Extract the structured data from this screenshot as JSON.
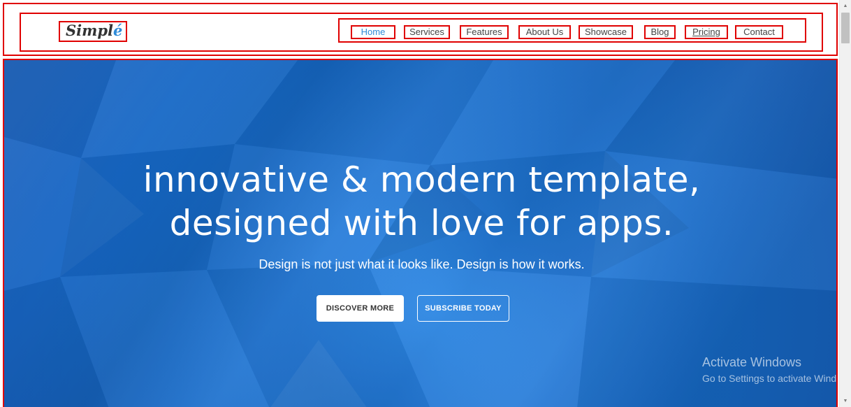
{
  "header": {
    "logo": {
      "text_main": "Simpl",
      "text_accent": "é"
    },
    "nav": {
      "active_color": "#2f8bd8",
      "items": [
        {
          "label": "Home",
          "active": true
        },
        {
          "label": "Services",
          "active": false
        },
        {
          "label": "Features",
          "active": false
        },
        {
          "label": "About Us",
          "active": false
        },
        {
          "label": "Showcase",
          "active": false
        },
        {
          "label": "Blog",
          "active": false
        },
        {
          "label": "Pricing",
          "active": false
        },
        {
          "label": "Contact",
          "active": false
        }
      ]
    }
  },
  "hero": {
    "background_color": "#1a6fd0",
    "title_line1": "innovative & modern template,",
    "title_line2": "designed with love for apps.",
    "subtitle": "Design is not just what it looks like. Design is how it works.",
    "buttons": {
      "discover": "DISCOVER MORE",
      "subscribe": "SUBSCRIBE TODAY"
    }
  },
  "watermark": {
    "title": "Activate Windows",
    "subtitle": "Go to Settings to activate Windows."
  },
  "scrollbar": {
    "up_icon": "scroll-up-arrow",
    "down_icon": "scroll-down-arrow"
  }
}
